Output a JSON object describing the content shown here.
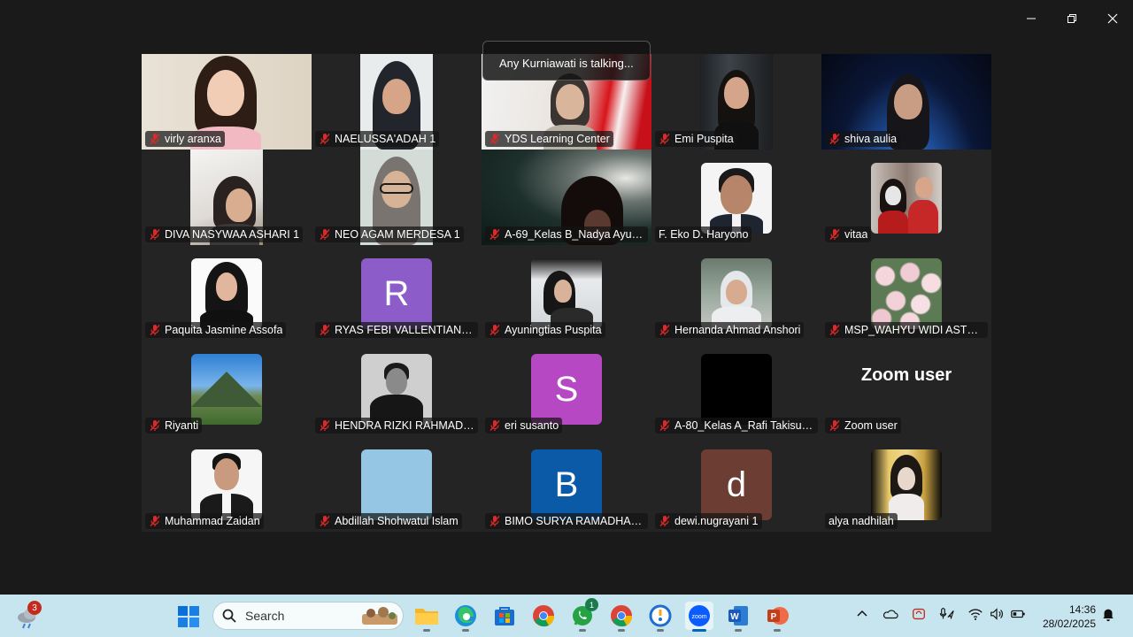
{
  "talking_banner": "Any Kurniawati is talking...",
  "participants": [
    {
      "name": "virly aranxa",
      "muted": true,
      "kind": "video"
    },
    {
      "name": "NAELUSSA'ADAH 1",
      "muted": true,
      "kind": "video"
    },
    {
      "name": "YDS Learning Center",
      "muted": true,
      "kind": "video"
    },
    {
      "name": "Emi Puspita",
      "muted": true,
      "kind": "video"
    },
    {
      "name": "shiva aulia",
      "muted": true,
      "kind": "video"
    },
    {
      "name": "DIVA NASYWAA ASHARI 1",
      "muted": true,
      "kind": "video"
    },
    {
      "name": "NEO AGAM MERDESA 1",
      "muted": true,
      "kind": "video"
    },
    {
      "name": "A-69_Kelas B_Nadya Ayu Gi...",
      "muted": true,
      "kind": "video"
    },
    {
      "name": "F. Eko D. Haryono",
      "muted": false,
      "kind": "photo"
    },
    {
      "name": "vitaa",
      "muted": true,
      "kind": "photo"
    },
    {
      "name": "Paquita Jasmine Assofa",
      "muted": true,
      "kind": "photo"
    },
    {
      "name": "RYAS FEBI VALLENTIANA PU...",
      "muted": true,
      "kind": "letter",
      "letter": "R",
      "color": "#8c5cc8"
    },
    {
      "name": "Ayuningtias Puspita",
      "muted": true,
      "kind": "photo"
    },
    {
      "name": "Hernanda Ahmad Anshori",
      "muted": true,
      "kind": "photo"
    },
    {
      "name": "MSP_WAHYU WIDI ASTUTI",
      "muted": true,
      "kind": "photo"
    },
    {
      "name": "Riyanti",
      "muted": true,
      "kind": "photo"
    },
    {
      "name": "HENDRA RIZKI RAHMADANI...",
      "muted": true,
      "kind": "photo"
    },
    {
      "name": "eri susanto",
      "muted": true,
      "kind": "letter",
      "letter": "S",
      "color": "#b748c4"
    },
    {
      "name": "A-80_Kelas A_Rafi Takisuza...",
      "muted": true,
      "kind": "black"
    },
    {
      "name": "Zoom user",
      "muted": true,
      "kind": "text",
      "display_text": "Zoom user"
    },
    {
      "name": "Muhammad Zaidan",
      "muted": true,
      "kind": "photo"
    },
    {
      "name": "Abdillah Shohwatul Islam",
      "muted": true,
      "kind": "photo"
    },
    {
      "name": "BIMO SURYA RAMADHANA 1",
      "muted": true,
      "kind": "letter",
      "letter": "B",
      "color": "#0b5aa8"
    },
    {
      "name": "dewi.nugrayani 1",
      "muted": true,
      "kind": "letter",
      "letter": "d",
      "color": "#6b3d33"
    },
    {
      "name": "alya nadhilah",
      "muted": false,
      "kind": "photo"
    }
  ],
  "taskbar": {
    "weather_badge": "3",
    "search_placeholder": "Search",
    "whatsapp_badge": "1",
    "time": "14:36",
    "date": "28/02/2025"
  },
  "colors": {
    "accent": "#0067c0",
    "mute_red": "#e02828",
    "taskbar_bg": "#c7e5ee"
  }
}
